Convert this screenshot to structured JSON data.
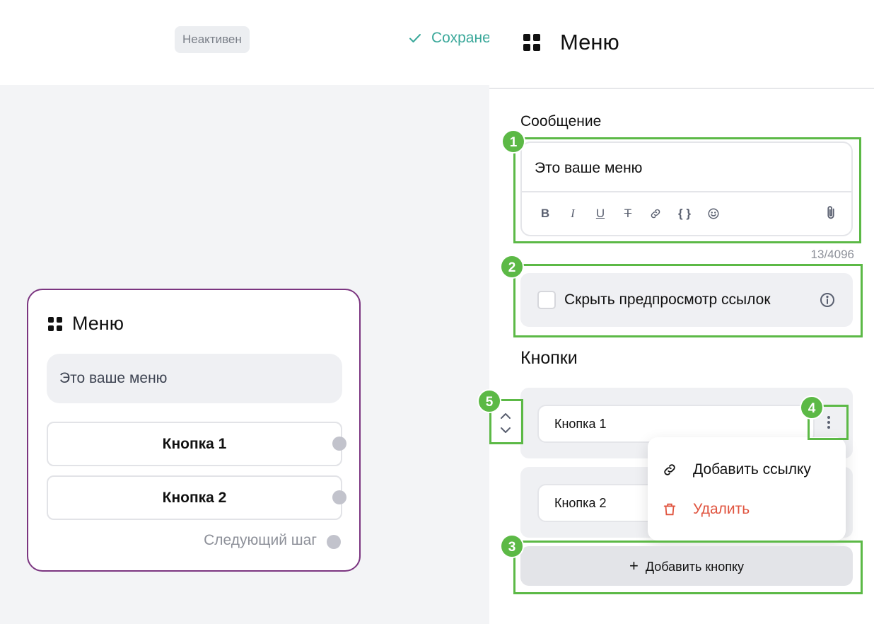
{
  "topbar": {
    "status": "Неактивен",
    "saved_label": "Сохране"
  },
  "node": {
    "title": "Меню",
    "message": "Это ваше меню",
    "buttons": [
      "Кнопка 1",
      "Кнопка 2"
    ],
    "next_step": "Следующий шаг"
  },
  "panel": {
    "title": "Меню",
    "message_label": "Сообщение",
    "message_value": "Это ваше меню",
    "counter": "13/4096",
    "toolbar": {
      "bold": "B",
      "italic": "I",
      "underline": "U",
      "strike": "T",
      "code": "{ }"
    },
    "hide_preview_label": "Скрыть предпросмотр ссылок",
    "buttons_label": "Кнопки",
    "buttons": [
      "Кнопка 1",
      "Кнопка 2"
    ],
    "dropdown": {
      "add_link": "Добавить ссылку",
      "delete": "Удалить"
    },
    "add_button": "Добавить кнопку"
  },
  "annotations": [
    "1",
    "2",
    "3",
    "4",
    "5"
  ],
  "colors": {
    "node_border": "#7b3580",
    "saved": "#3aa89a",
    "highlight": "#5cb946",
    "danger": "#e0543f"
  }
}
